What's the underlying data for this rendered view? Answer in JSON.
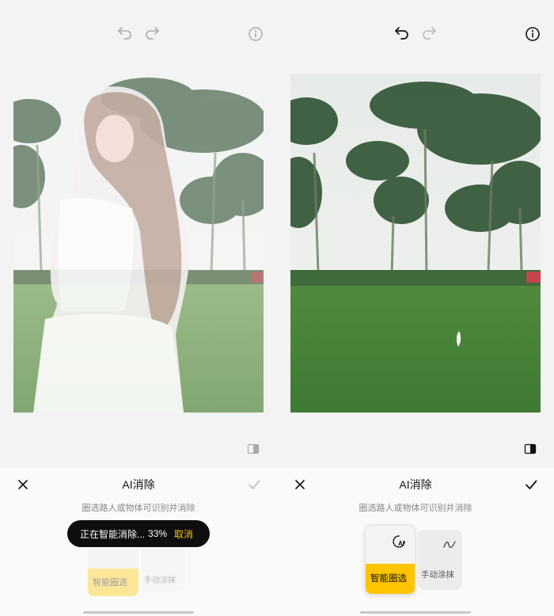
{
  "left": {
    "topbar": {
      "undo_icon": "undo-icon",
      "redo_icon": "redo-icon",
      "info_icon": "info-icon"
    },
    "sheet": {
      "title": "AI消除",
      "hint": "圈选路人或物体可识别并消除"
    },
    "tools": [
      {
        "label": "智能圈选",
        "icon": "ai-lasso-icon",
        "selected": true
      },
      {
        "label": "手动涂抹",
        "icon": "brush-icon",
        "selected": false
      }
    ],
    "toast": {
      "text": "正在智能消除...",
      "percent": "33%",
      "cancel": "取消"
    }
  },
  "right": {
    "topbar": {
      "undo_icon": "undo-icon",
      "redo_icon": "redo-icon",
      "info_icon": "info-icon"
    },
    "sheet": {
      "title": "AI消除",
      "hint": "圈选路人或物体可识别并消除"
    },
    "tools": [
      {
        "label": "智能圈选",
        "icon": "ai-lasso-icon",
        "selected": true
      },
      {
        "label": "手动涂抹",
        "icon": "brush-icon",
        "selected": false
      }
    ]
  },
  "colors": {
    "accent": "#ffc400",
    "toast_bg": "#0e0e0e",
    "panel_bg": "#f3f3f3"
  }
}
